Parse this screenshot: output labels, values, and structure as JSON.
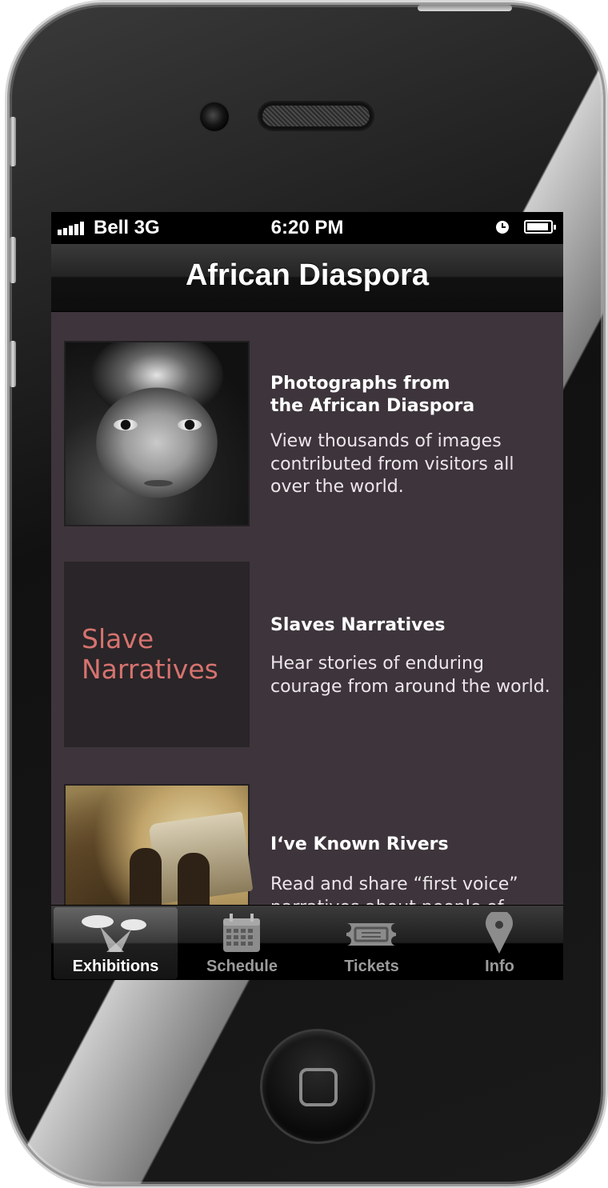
{
  "status_bar": {
    "carrier": "Bell 3G",
    "time": "6:20 PM"
  },
  "nav": {
    "title": "African Diaspora"
  },
  "items": [
    {
      "title": "Photographs from\nthe African Diaspora",
      "description": "View thousands of images contributed from visitors all over the world."
    },
    {
      "thumb_label": "Slave Narratives",
      "title": "Slaves Narratives",
      "description": "Hear stories of enduring courage from around the world."
    },
    {
      "title": "I‘ve Known Rivers",
      "description": "Read and share “first voice” narratives about people of"
    }
  ],
  "tabs": [
    {
      "label": "Exhibitions",
      "icon": "spotlights-icon",
      "active": true
    },
    {
      "label": "Schedule",
      "icon": "calendar-icon",
      "active": false
    },
    {
      "label": "Tickets",
      "icon": "ticket-icon",
      "active": false
    },
    {
      "label": "Info",
      "icon": "location-pin-icon",
      "active": false
    }
  ],
  "colors": {
    "content_background": "#3d353b",
    "thumb_text_color": "#d6736f"
  }
}
